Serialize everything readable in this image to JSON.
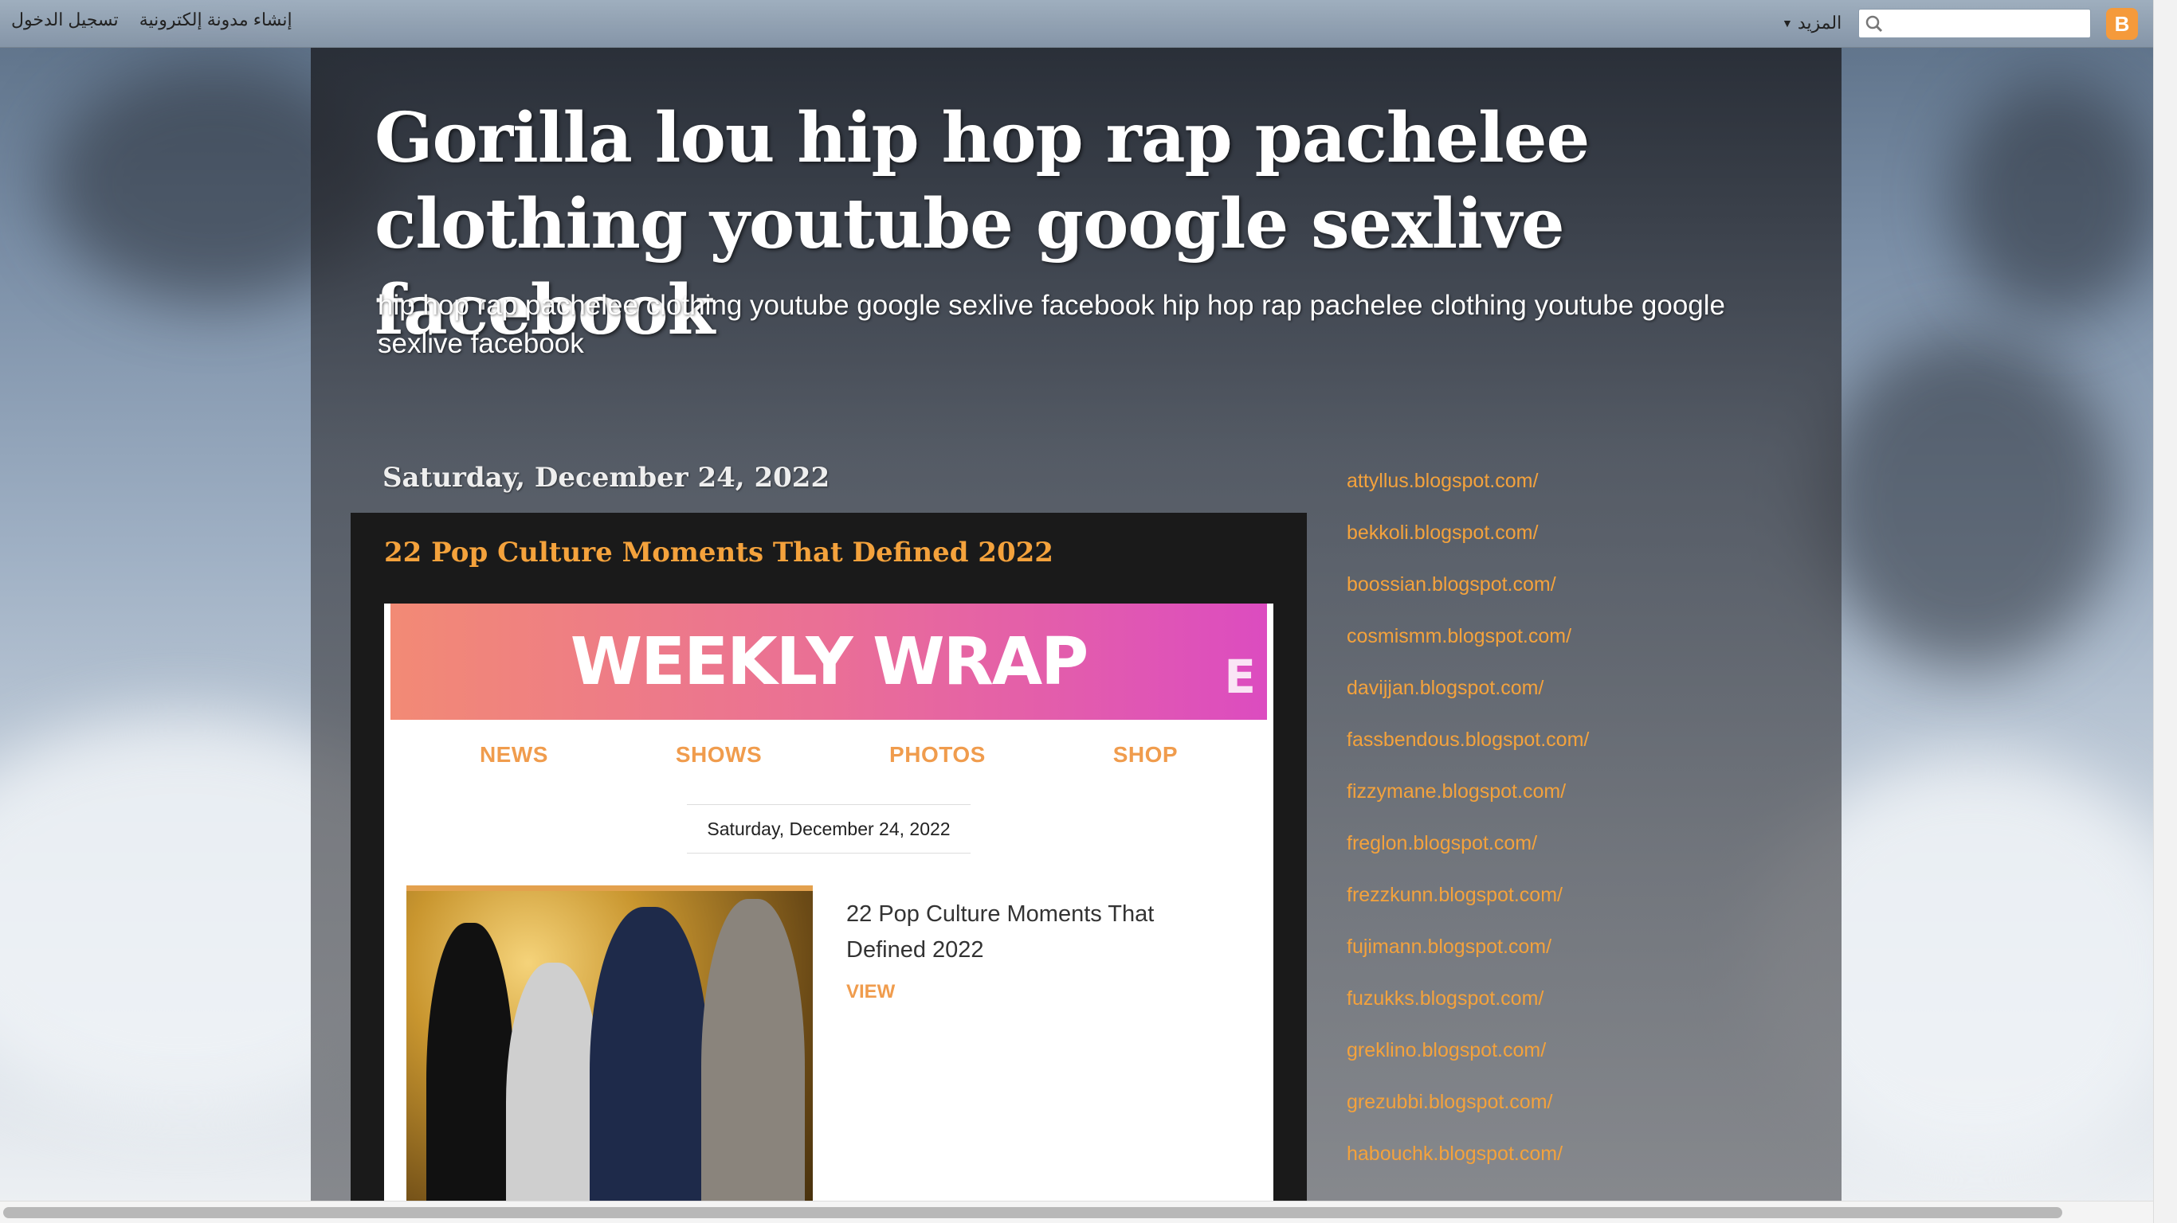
{
  "navbar": {
    "more_label": "المزيد",
    "search_placeholder": "",
    "links": [
      "تسجيل الدخول",
      "إنشاء مدونة إلكترونية"
    ]
  },
  "blog": {
    "title": "Gorilla lou hip hop rap pachelee clothing youtube google sexlive facebook",
    "description": "hip hop rap pachelee clothing youtube google sexlive facebook hip hop rap pachelee clothing youtube google sexlive facebook"
  },
  "post": {
    "date_header": "Saturday, December 24, 2022",
    "title": "22 Pop Culture Moments That Defined 2022",
    "email": {
      "banner_text": "WEEKLY WRAP",
      "brand_mark": "E",
      "nav": [
        "NEWS",
        "SHOWS",
        "PHOTOS",
        "SHOP"
      ],
      "date": "Saturday, December 24, 2022",
      "story_title": "22 Pop Culture Moments That Defined 2022",
      "story_cta": "VIEW"
    }
  },
  "sidebar": {
    "links": [
      "attyllus.blogspot.com/",
      "bekkoli.blogspot.com/",
      "boossian.blogspot.com/",
      "cosmismm.blogspot.com/",
      "davijjan.blogspot.com/",
      "fassbendous.blogspot.com/",
      "fizzymane.blogspot.com/",
      "freglon.blogspot.com/",
      "frezzkunn.blogspot.com/",
      "fujimann.blogspot.com/",
      "fuzukks.blogspot.com/",
      "greklino.blogspot.com/",
      "grezubbi.blogspot.com/",
      "habouchk.blogspot.com/"
    ]
  },
  "colors": {
    "accent": "#f4a23c",
    "banner_start": "#f28a75",
    "banner_end": "#dc4cc0",
    "blogger_logo": "#f59a3b"
  }
}
